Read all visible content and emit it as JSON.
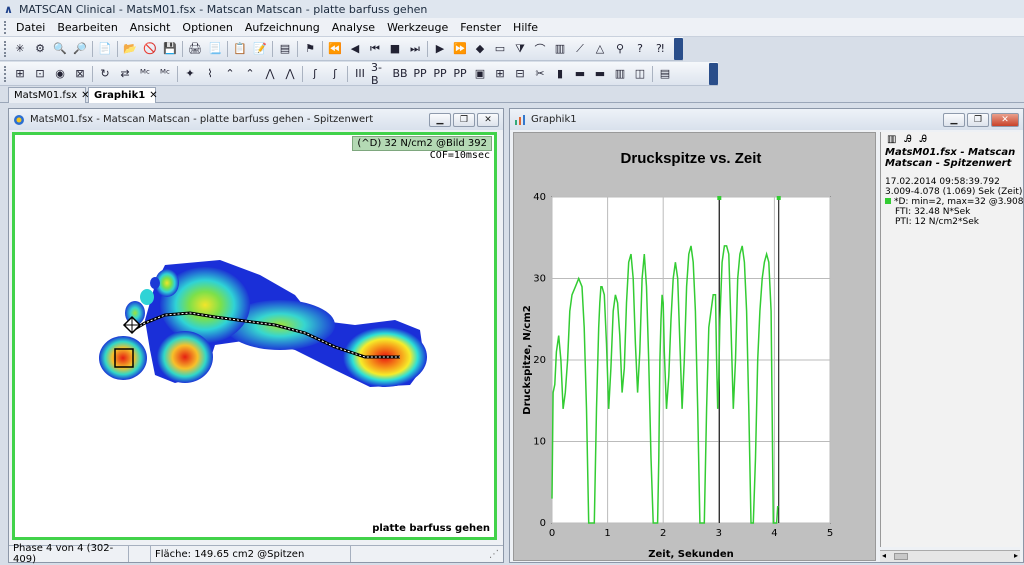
{
  "app": {
    "title": "MATSCAN Clinical - MatsM01.fsx - Matscan  Matscan - platte barfuss gehen"
  },
  "menu": [
    "Datei",
    "Bearbeiten",
    "Ansicht",
    "Optionen",
    "Aufzeichnung",
    "Analyse",
    "Werkzeuge",
    "Fenster",
    "Hilfe"
  ],
  "toolbar1": [
    "✳",
    "⚙",
    "🔍",
    "🔎",
    "|",
    "📄",
    "|",
    "📂",
    "🚫",
    "💾",
    "|",
    "🖨",
    "📃",
    "|",
    "📋",
    "📝",
    "|",
    "▤",
    "|",
    "⚑",
    "|",
    "⏪",
    "◀",
    "⏮",
    "■",
    "⏭",
    "|",
    "▶",
    "⏩",
    "◆",
    "▭",
    "⧩",
    "⌒",
    "▥",
    "⟋",
    "△",
    "⚲",
    "?",
    "⁈"
  ],
  "toolbar2": [
    "⊞",
    "⊡",
    "◉",
    "⊠",
    "|",
    "↻",
    "⇄",
    "ᴹᶜ",
    "ᴹᶜ",
    "|",
    "✦",
    "⌇",
    "⌃",
    "⌃",
    "⋀",
    "⋀",
    "|",
    "ʃ",
    "ʃ",
    "|",
    "III",
    "3-B",
    "BB",
    "PP",
    "PP",
    "PP",
    "▣",
    "⊞",
    "⊟",
    "✂",
    "▮",
    "▬",
    "▬",
    "▥",
    "◫",
    "|",
    "▤"
  ],
  "tabs": [
    {
      "label": "MatsM01.fsx"
    },
    {
      "label": "Graphik1"
    }
  ],
  "left_window": {
    "title": "MatsM01.fsx - Matscan  Matscan - platte barfuss gehen - Spitzenwert",
    "overlay": "(^D) 32 N/cm2 @Bild 392",
    "cof": "COF=10msec",
    "profile_name": "platte barfuss gehen",
    "status": {
      "phase": "Phase 4 von 4 (302-409)",
      "area": "Fläche: 149.65 cm2 @Spitzen"
    }
  },
  "right_window": {
    "title": "Graphik1",
    "legend": {
      "title": "MatsM01.fsx - Matscan  Matscan - Spitzenwert",
      "timestamp": "17.02.2014 09:58:39.792",
      "range": "3.009-4.078 (1.069) Sek (Zeit)",
      "series": "*D: min=2, max=32 @3.908 Sek",
      "fti": "FTI: 32.48 N*Sek",
      "pti": "PTI: 12 N/cm2*Sek"
    }
  },
  "colors": {
    "series": "#33cc33",
    "border_green": "#41d24a"
  },
  "chart_data": {
    "type": "line",
    "title": "Druckspitze vs. Zeit",
    "xlabel": "Zeit, Sekunden",
    "ylabel": "Druckspitze, N/cm2",
    "xlim": [
      0,
      5
    ],
    "ylim": [
      0,
      40
    ],
    "xticks": [
      0,
      1,
      2,
      3,
      4,
      5
    ],
    "yticks": [
      0,
      10,
      20,
      30,
      40
    ],
    "grid": true,
    "vlines": [
      3.009,
      4.078
    ],
    "series": [
      {
        "x": [
          0.0,
          0.02,
          0.05,
          0.08,
          0.12,
          0.16,
          0.2,
          0.24,
          0.28,
          0.32,
          0.36,
          0.42,
          0.48,
          0.54,
          0.58,
          0.62,
          0.66,
          0.7,
          0.72,
          0.76,
          0.8,
          0.84,
          0.86,
          0.88,
          0.9,
          0.94,
          0.98,
          1.02,
          1.06,
          1.1,
          1.14,
          1.18,
          1.22,
          1.26,
          1.3,
          1.34,
          1.38,
          1.42,
          1.46,
          1.5,
          1.54,
          1.58,
          1.62,
          1.66,
          1.7,
          1.74,
          1.78,
          1.82,
          1.86,
          1.9,
          1.92,
          1.94,
          1.96,
          1.98,
          2.0,
          2.02,
          2.06,
          2.1,
          2.14,
          2.18,
          2.22,
          2.26,
          2.3,
          2.34,
          2.38,
          2.42,
          2.46,
          2.5,
          2.54,
          2.58,
          2.62,
          2.66,
          2.7,
          2.74,
          2.78,
          2.82,
          2.86,
          2.9,
          2.94,
          2.96,
          2.98,
          3.0,
          3.02,
          3.06,
          3.1,
          3.14,
          3.18,
          3.22,
          3.26,
          3.3,
          3.34,
          3.38,
          3.42,
          3.46,
          3.5,
          3.54,
          3.58,
          3.62,
          3.66,
          3.7,
          3.74,
          3.78,
          3.82,
          3.86,
          3.9,
          3.94,
          3.98,
          4.02,
          4.04,
          4.06,
          4.08
        ],
        "y": [
          3,
          16,
          17,
          21,
          23,
          20,
          14,
          16,
          20,
          26,
          28,
          29,
          30,
          29,
          24,
          14,
          0,
          0,
          0,
          0,
          14,
          24,
          27,
          29,
          29,
          28,
          22,
          14,
          19,
          26,
          28,
          27,
          23,
          16,
          19,
          27,
          32,
          33,
          30,
          22,
          16,
          21,
          30,
          33,
          29,
          20,
          8,
          0,
          0,
          0,
          8,
          20,
          25,
          28,
          27,
          21,
          14,
          18,
          25,
          30,
          32,
          30,
          22,
          14,
          20,
          29,
          33,
          34,
          32,
          26,
          14,
          0,
          0,
          0,
          14,
          24,
          26,
          28,
          28,
          20,
          14,
          18,
          25,
          32,
          34,
          34,
          33,
          24,
          14,
          20,
          30,
          33,
          34,
          32,
          26,
          14,
          0,
          0,
          8,
          20,
          26,
          30,
          32,
          33,
          32,
          26,
          0,
          0,
          0,
          2,
          2
        ]
      }
    ]
  }
}
